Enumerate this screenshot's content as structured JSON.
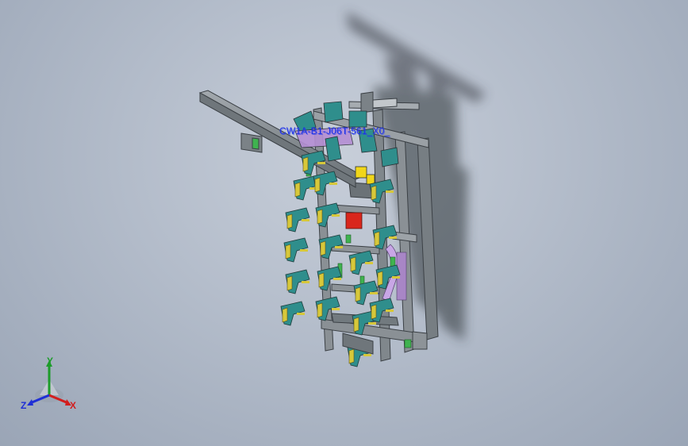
{
  "viewport": {
    "background_top": "#c7ced9",
    "background_bottom": "#9aa5b6"
  },
  "model": {
    "label": "CW1A-B1-J06T-561_X0_",
    "frame_color": "#7f868c",
    "clamp_color": "#2f8e8c",
    "bracket_color": "#d7c83a",
    "accent_red": "#d9261c",
    "accent_yellow": "#f1d61a",
    "accent_green": "#3fb34f",
    "accent_purple": "#b58fd4"
  },
  "triad": {
    "x_label": "X",
    "y_label": "Y",
    "z_label": "Z",
    "x_color": "#d21e1e",
    "y_color": "#1c9c2a",
    "z_color": "#1f2fd6"
  }
}
